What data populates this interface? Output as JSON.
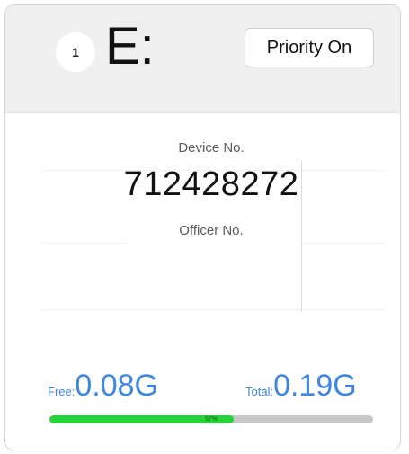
{
  "header": {
    "slot_number": "1",
    "drive_letter": "E:",
    "priority_button_label": "Priority On"
  },
  "device": {
    "device_label": "Device No.",
    "device_number": "712428272",
    "officer_label": "Officer No."
  },
  "storage": {
    "free_label": "Free:",
    "free_value": "0.08G",
    "total_label": "Total:",
    "total_value": "0.19G",
    "usage_percent_text": "57%",
    "usage_fraction": 0.57
  },
  "colors": {
    "accent": "#3f86e0",
    "progress_fill": "#28d13a",
    "progress_track": "#c8c8c8",
    "header_bg": "#efefef"
  }
}
